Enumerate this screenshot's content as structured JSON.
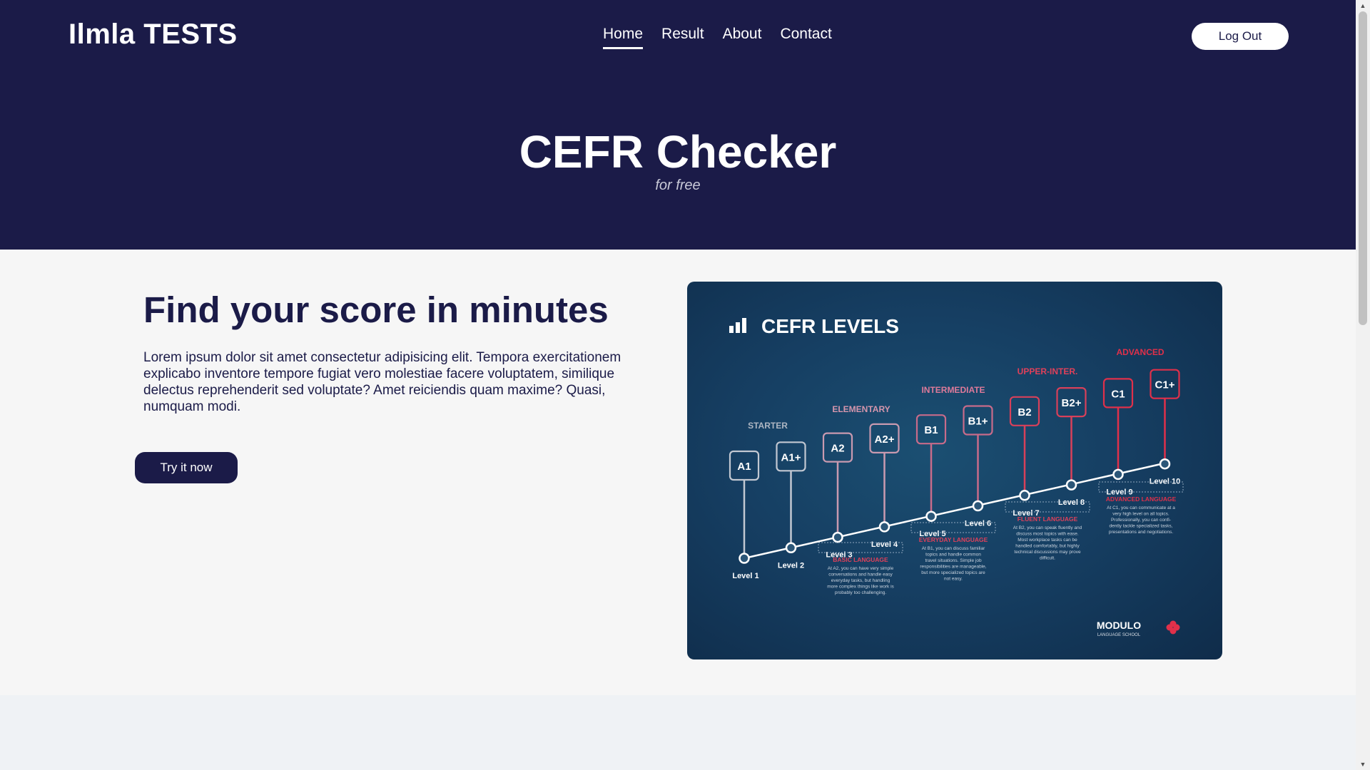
{
  "brand": "Ilmla TESTS",
  "nav": [
    {
      "label": "Home",
      "active": true
    },
    {
      "label": "Result",
      "active": false
    },
    {
      "label": "About",
      "active": false
    },
    {
      "label": "Contact",
      "active": false
    }
  ],
  "logout_label": "Log Out",
  "hero": {
    "title": "CEFR Checker",
    "subtitle": "for free"
  },
  "main": {
    "title": "Find your score in minutes",
    "text": "Lorem ipsum dolor sit amet consectetur adipisicing elit. Tempora exercitationem explicabo inventore tempore fugiat vero molestiae facere voluptatem, similique delectus reprehenderit sed voluptate? Amet reiciendis quam maxime? Quasi, numquam modi.",
    "cta": "Try it now"
  },
  "infographic": {
    "title": "CEFR LEVELS",
    "chart_icon": "bar-chart-icon",
    "groups": {
      "starter": "STARTER",
      "elementary": "ELEMENTARY",
      "intermediate": "INTERMEDIATE",
      "upper": "UPPER-INTER.",
      "advanced": "ADVANCED"
    },
    "levels": [
      {
        "badge": "A1",
        "label": "Level 1"
      },
      {
        "badge": "A1+",
        "label": "Level 2"
      },
      {
        "badge": "A2",
        "label": "Level 3"
      },
      {
        "badge": "A2+",
        "label": "Level 4"
      },
      {
        "badge": "B1",
        "label": "Level 5"
      },
      {
        "badge": "B1+",
        "label": "Level 6"
      },
      {
        "badge": "B2",
        "label": "Level 7"
      },
      {
        "badge": "B2+",
        "label": "Level 8"
      },
      {
        "badge": "C1",
        "label": "Level 9"
      },
      {
        "badge": "C1+",
        "label": "Level 10"
      }
    ],
    "descriptions": {
      "basic": {
        "title": "BASIC LANGUAGE",
        "lines": [
          "At A2, you can have very simple",
          "conversations and handle easy",
          "everyday tasks, but handling",
          "more complex things like work is",
          "probably too challenging."
        ]
      },
      "everyday": {
        "title": "EVERYDAY LANGUAGE",
        "lines": [
          "At B1, you can discuss familiar",
          "topics and handle common",
          "travel situations. Simple job",
          "responsibilities are manageable,",
          "but more specialized topics are",
          "not easy."
        ]
      },
      "fluent": {
        "title": "FLUENT LANGUAGE",
        "lines": [
          "At B2, you can speak fluently and",
          "discuss most topics with ease.",
          "Most workplace tasks can be",
          "handled comfortably, but highly",
          "technical discussions may prove",
          "difficult."
        ]
      },
      "advanced": {
        "title": "ADVANCED LANGUAGE",
        "lines": [
          "At C1, you can communicate at a",
          "very high level on all topics.",
          "Professionally, you can confi-",
          "dently tackle specialized tasks,",
          "presentations and negotiations."
        ]
      }
    },
    "logo": {
      "name": "MODULO",
      "sub": "LANGUAGE SCHOOL"
    }
  },
  "colors": {
    "navy": "#1b1b48",
    "card_blue": "#163f63",
    "red_accent": "#e0304a",
    "pink_accent": "#c86b8a",
    "grey_accent": "#c2c8d2"
  }
}
